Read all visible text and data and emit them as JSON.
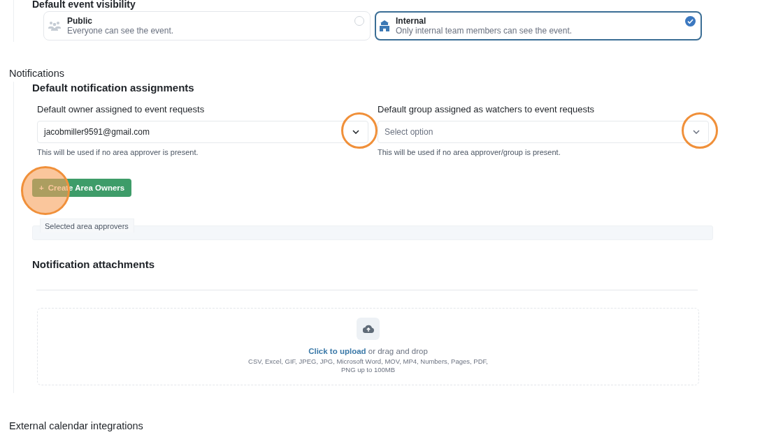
{
  "visibility": {
    "heading": "Default event visibility",
    "options": [
      {
        "kind": "public",
        "title": "Public",
        "description": "Everyone can see the event.",
        "selected": false
      },
      {
        "kind": "internal",
        "title": "Internal",
        "description": "Only internal team members can see the event.",
        "selected": true
      }
    ]
  },
  "notifications": {
    "heading": "Notifications",
    "assignments": {
      "heading": "Default notification assignments",
      "fields": [
        {
          "label": "Default owner assigned to event requests",
          "value": "jacobmiller9591@gmail.com",
          "help": "This will be used if no area approver is present.",
          "highlighted": true
        },
        {
          "label": "Default group assigned as watchers to event requests",
          "placeholder": "Select option",
          "help": "This will be used if no area approver/group is present.",
          "highlighted": true
        }
      ]
    },
    "create_button": {
      "icon": "+",
      "label": "Create Area Owners",
      "highlighted": true
    },
    "approvers_tab": "Selected area approvers",
    "attachments": {
      "heading": "Notification attachments",
      "upload_link": "Click to upload",
      "upload_text": "or drag and drop",
      "formats": "CSV, Excel, GIF, JPEG, JPG, Microsoft Word, MOV, MP4, Numbers, Pages, PDF, PNG up to 100MB"
    }
  },
  "external": {
    "heading": "External calendar integrations"
  }
}
